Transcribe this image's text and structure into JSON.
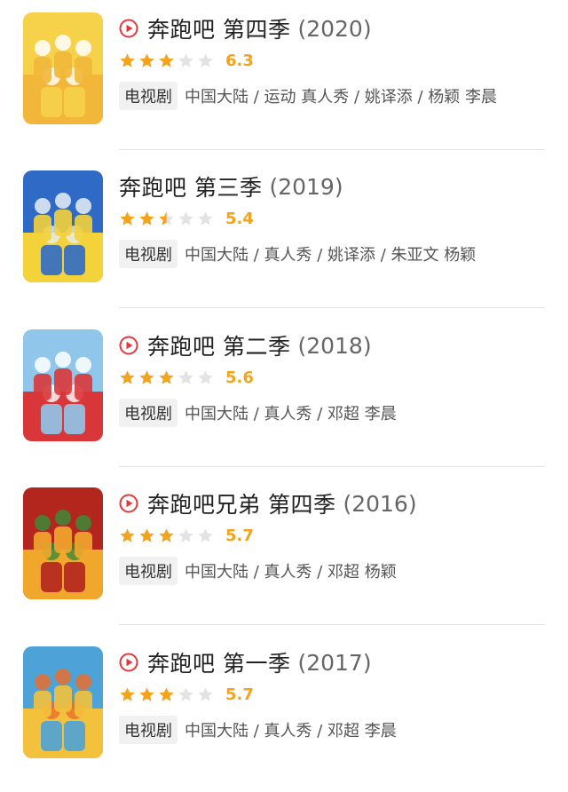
{
  "items": [
    {
      "has_play": true,
      "title": "奔跑吧 第四季",
      "year": "(2020)",
      "stars": [
        1,
        1,
        1,
        0,
        0
      ],
      "score": "6.3",
      "tag": "电视剧",
      "meta": "中国大陆 / 运动 真人秀 / 姚译添 / 杨颖 李晨",
      "poster_colors": [
        "#f6d24a",
        "#f2b73a",
        "#ffffff"
      ]
    },
    {
      "has_play": false,
      "title": "奔跑吧 第三季",
      "year": "(2019)",
      "stars": [
        1,
        1,
        0.5,
        0,
        0
      ],
      "score": "5.4",
      "tag": "电视剧",
      "meta": "中国大陆 / 真人秀 / 姚译添 / 朱亚文 杨颖",
      "poster_colors": [
        "#2f6bc6",
        "#f4d23a",
        "#e9eef6"
      ]
    },
    {
      "has_play": true,
      "title": "奔跑吧 第二季",
      "year": "(2018)",
      "stars": [
        1,
        1,
        1,
        0,
        0
      ],
      "score": "5.6",
      "tag": "电视剧",
      "meta": "中国大陆 / 真人秀 / 邓超 李晨",
      "poster_colors": [
        "#8fc6ea",
        "#d9363a",
        "#ffffff"
      ]
    },
    {
      "has_play": true,
      "title": "奔跑吧兄弟 第四季",
      "year": "(2016)",
      "stars": [
        1,
        1,
        1,
        0,
        0
      ],
      "score": "5.7",
      "tag": "电视剧",
      "meta": "中国大陆 / 真人秀 / 邓超 杨颖",
      "poster_colors": [
        "#b3261e",
        "#f1a72c",
        "#3d8a3a"
      ]
    },
    {
      "has_play": true,
      "title": "奔跑吧 第一季",
      "year": "(2017)",
      "stars": [
        1,
        1,
        1,
        0,
        0
      ],
      "score": "5.7",
      "tag": "电视剧",
      "meta": "中国大陆 / 真人秀 / 邓超 李晨",
      "poster_colors": [
        "#4da3d8",
        "#f3c13b",
        "#e86f2f"
      ]
    }
  ]
}
